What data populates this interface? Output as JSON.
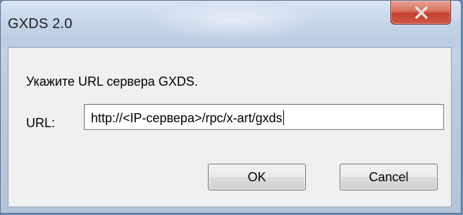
{
  "window": {
    "title": "GXDS 2.0",
    "close_icon": "close-x-icon"
  },
  "dialog": {
    "prompt": "Укажите URL сервера GXDS.",
    "url_label": "URL:",
    "url_value": "http://<IP-сервера>/rpc/x-art/gxds"
  },
  "buttons": {
    "ok_label": "OK",
    "cancel_label": "Cancel"
  },
  "colors": {
    "close_button": "#c2412f",
    "dialog_background": "#f0f0f0",
    "titlebar": "#c4d4e8"
  }
}
